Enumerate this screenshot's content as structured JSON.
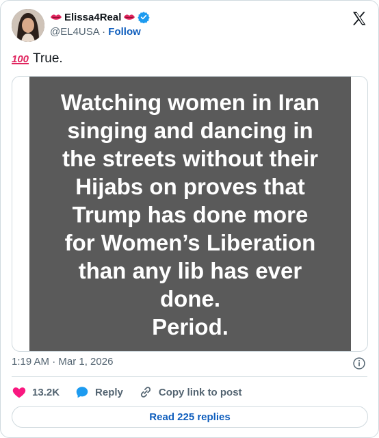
{
  "author": {
    "display_name": "Elissa4Real",
    "handle": "@EL4USA",
    "separator": "·",
    "follow_label": "Follow"
  },
  "tweet": {
    "emoji_label": "100",
    "text": "True."
  },
  "media": {
    "text": "Watching women in Iran\nsinging and dancing in\nthe streets without their\nHijabs on proves that\nTrump has done more\nfor Women’s Liberation\nthan any lib has ever\ndone.\nPeriod."
  },
  "meta": {
    "timestamp": "1:19 AM · Mar 1, 2026"
  },
  "actions": {
    "likes": "13.2K",
    "reply_label": "Reply",
    "copy_label": "Copy link to post"
  },
  "replies_button": "Read 225 replies",
  "colors": {
    "like": "#f91880",
    "reply": "#1d9bf0",
    "link": "#0f5ebd",
    "verified": "#1d9bf0",
    "media_bg": "#5a5a5a"
  }
}
